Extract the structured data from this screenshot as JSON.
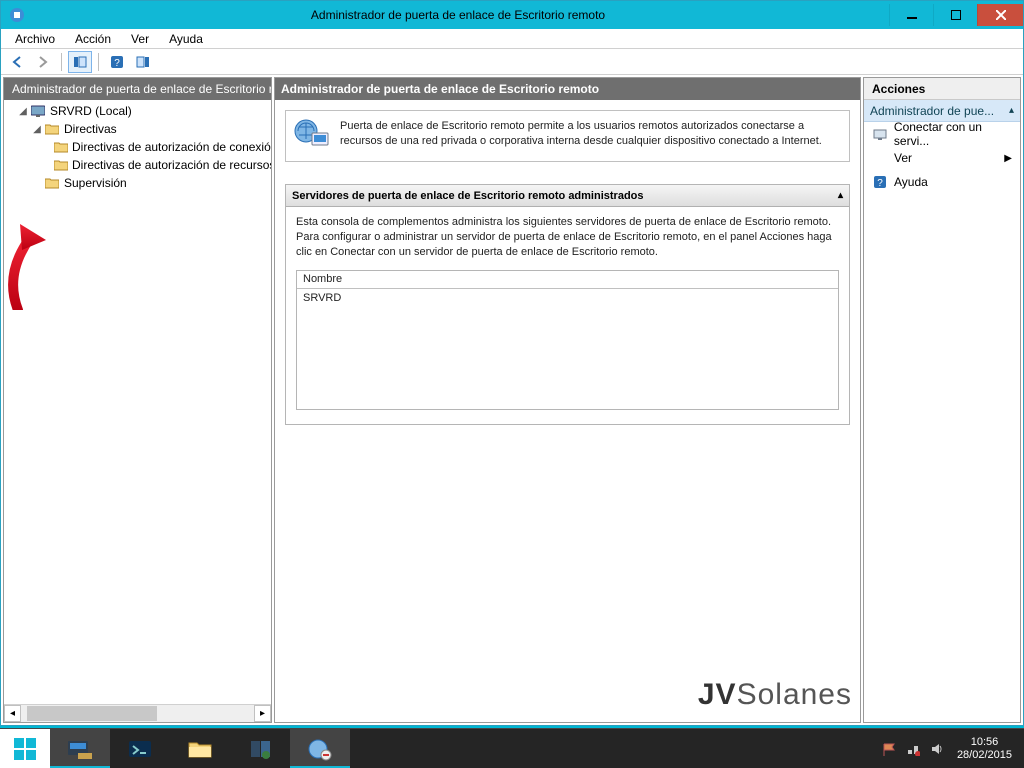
{
  "window": {
    "title": "Administrador de puerta de enlace de Escritorio remoto"
  },
  "menu": {
    "file": "Archivo",
    "action": "Acción",
    "view": "Ver",
    "help": "Ayuda"
  },
  "tree": {
    "header": "Administrador de puerta de enlace de Escritorio remoto",
    "root": "SRVRD (Local)",
    "policies": "Directivas",
    "policy_conn": "Directivas de autorización de conexión",
    "policy_res": "Directivas de autorización de recursos",
    "supervision": "Supervisión"
  },
  "content": {
    "header": "Administrador de puerta de enlace de Escritorio remoto",
    "intro": "Puerta de enlace de Escritorio remoto permite a los usuarios remotos autorizados conectarse a recursos de una red privada o corporativa interna desde cualquier dispositivo conectado a Internet.",
    "section_title": "Servidores de puerta de enlace de Escritorio remoto administrados",
    "section_desc": "Esta consola de complementos administra los siguientes servidores de puerta de enlace de Escritorio remoto. Para configurar o administrar un servidor de puerta de enlace de Escritorio remoto, en el panel Acciones haga clic en Conectar con un servidor de puerta de enlace de Escritorio remoto.",
    "table_col": "Nombre",
    "server": "SRVRD"
  },
  "actions": {
    "title": "Acciones",
    "entity": "Administrador de pue...",
    "connect": "Conectar con un servi...",
    "view": "Ver",
    "help": "Ayuda"
  },
  "watermark": "Solanes",
  "taskbar": {
    "time": "10:56",
    "date": "28/02/2015"
  }
}
